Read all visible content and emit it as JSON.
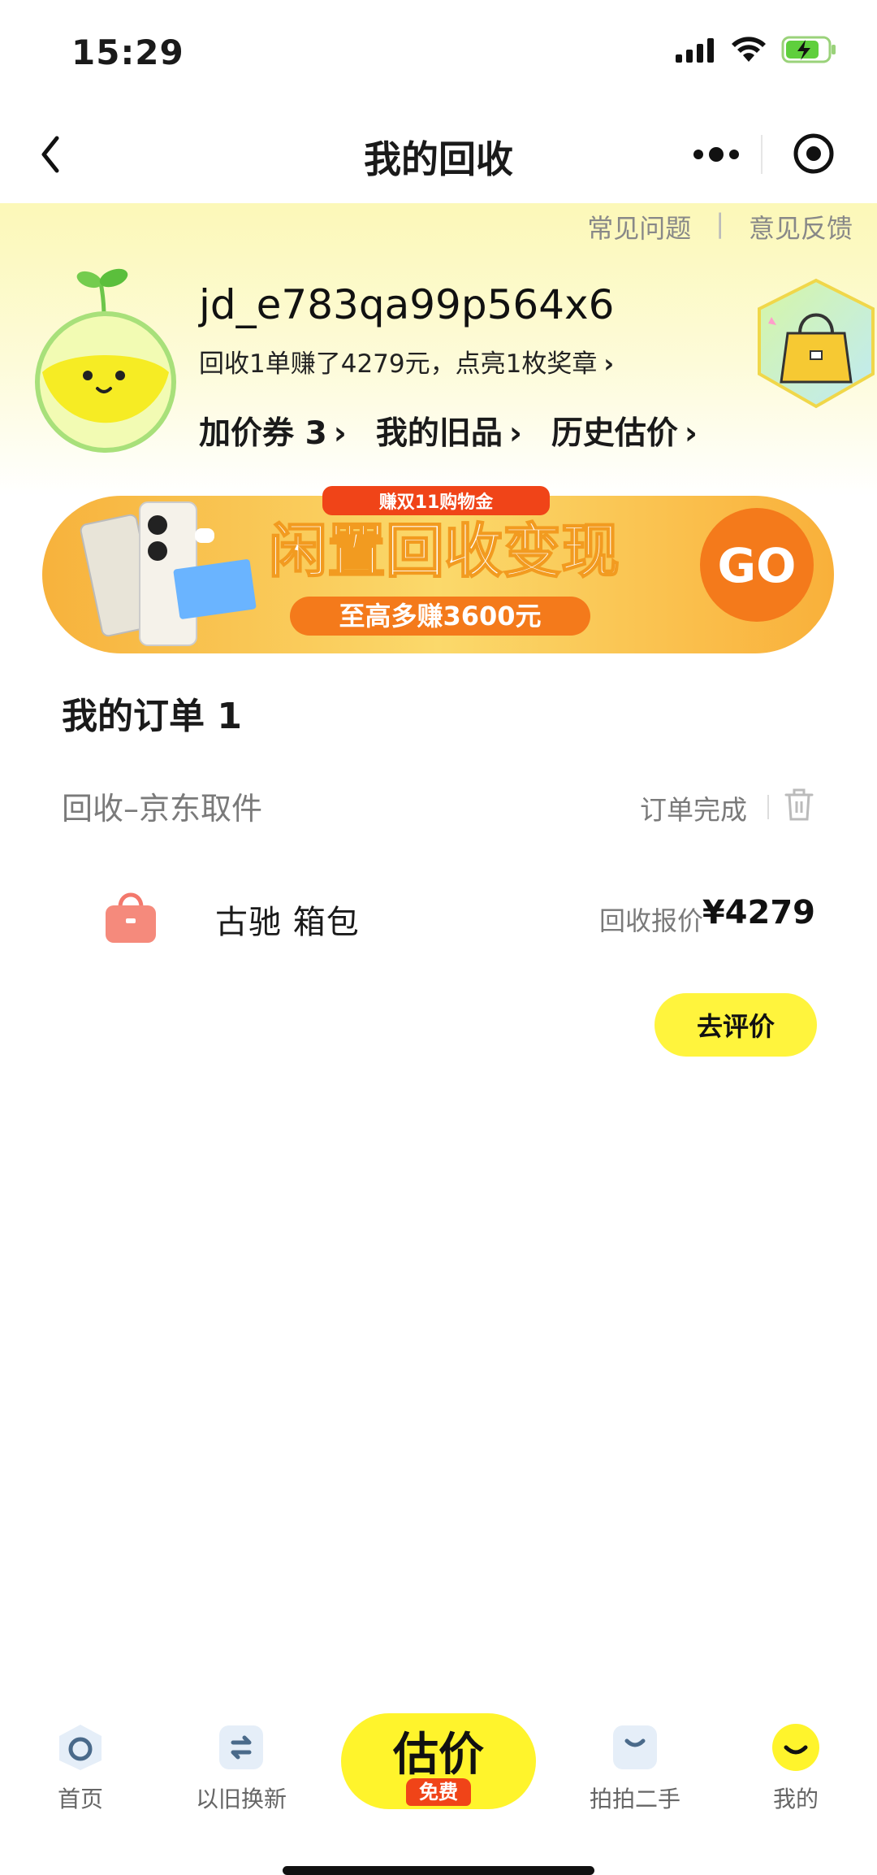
{
  "status_bar": {
    "time": "15:29"
  },
  "nav": {
    "title": "我的回收"
  },
  "hero": {
    "faq": "常见问题",
    "feedback": "意见反馈",
    "username": "jd_e783qa99p564x6",
    "earn_text": "回收1单赚了4279元，点亮1枚奖章",
    "links": [
      {
        "label": "加价券",
        "count": "3"
      },
      {
        "label": "我的旧品"
      },
      {
        "label": "历史估价"
      }
    ]
  },
  "banner": {
    "tag": "赚双11购物金",
    "headline": "闲置回收变现",
    "sub": "至高多赚3600元",
    "go": "GO"
  },
  "orders": {
    "title": "我的订单",
    "count": "1",
    "items": [
      {
        "type": "回收–京东取件",
        "status": "订单完成",
        "name": "古驰 箱包",
        "price_label": "回收报价",
        "price": "¥4279",
        "action": "去评价"
      }
    ]
  },
  "tabbar": {
    "items": [
      {
        "label": "首页",
        "icon": "home-icon"
      },
      {
        "label": "以旧换新",
        "icon": "trade-in-icon"
      },
      {
        "label": "估价",
        "badge": "免费",
        "icon": "estimate-icon"
      },
      {
        "label": "拍拍二手",
        "icon": "paipai-icon"
      },
      {
        "label": "我的",
        "icon": "mine-icon"
      }
    ]
  },
  "colors": {
    "accent_yellow": "#fff43d",
    "brand_orange": "#f47a1b",
    "tag_red": "#f04418"
  }
}
